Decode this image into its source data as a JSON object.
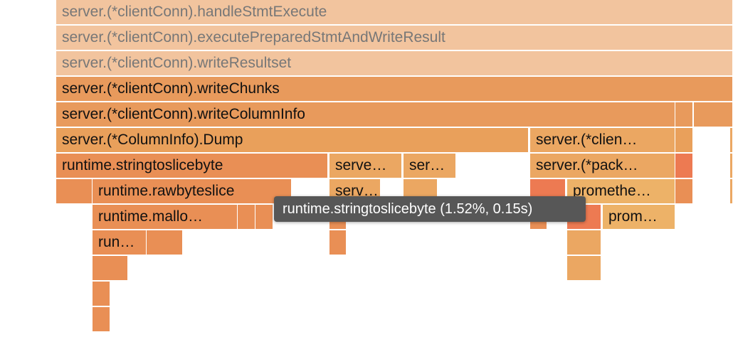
{
  "frames": [
    {
      "label": "server.(*clientConn).handleStmtExecute",
      "color": "#f2c49e",
      "dim": true
    },
    {
      "label": "server.(*clientConn).executePreparedStmtAndWriteResult",
      "color": "#f2c49e",
      "dim": true
    },
    {
      "label": "server.(*clientConn).writeResultset",
      "color": "#f2c49e",
      "dim": true
    },
    {
      "label": "server.(*clientConn).writeChunks",
      "color": "#e89a5c",
      "dim": false
    },
    {
      "label": "server.(*clientConn).writeColumnInfo",
      "color": "#e89a5c",
      "dim": false
    },
    {
      "label": "",
      "color": "#e89a5c",
      "dim": false
    },
    {
      "label": "",
      "color": "#e89a5c",
      "dim": false
    },
    {
      "label": "server.(*ColumnInfo).Dump",
      "color": "#e9a05b",
      "dim": false
    },
    {
      "label": "server.(*clien…",
      "color": "#eba762",
      "dim": false
    },
    {
      "label": "",
      "color": "#e9a05b",
      "dim": false
    },
    {
      "label": "",
      "color": "#eba762",
      "dim": false
    },
    {
      "label": "runtime.stringtoslicebyte",
      "color": "#e98f55",
      "dim": false
    },
    {
      "label": "serve…",
      "color": "#eba762",
      "dim": false
    },
    {
      "label": "ser…",
      "color": "#eba762",
      "dim": false
    },
    {
      "label": "server.(*pack…",
      "color": "#eba762",
      "dim": false
    },
    {
      "label": "",
      "color": "#ed7a52",
      "dim": false
    },
    {
      "label": "",
      "color": "#eba762",
      "dim": false
    },
    {
      "label": "",
      "color": "#e98f55",
      "dim": false
    },
    {
      "label": "runtime.rawbyteslice",
      "color": "#e98f55",
      "dim": false
    },
    {
      "label": "serve…",
      "color": "#eba762",
      "dim": false
    },
    {
      "label": "",
      "color": "#eba762",
      "dim": false
    },
    {
      "label": "",
      "color": "#ed7a52",
      "dim": false
    },
    {
      "label": "promethe…",
      "color": "#edb268",
      "dim": false
    },
    {
      "label": "",
      "color": "#e98f55",
      "dim": false
    },
    {
      "label": "",
      "color": "#eba762",
      "dim": false
    },
    {
      "label": "runtime.mallo…",
      "color": "#e98f55",
      "dim": false
    },
    {
      "label": "",
      "color": "#e98f55",
      "dim": false
    },
    {
      "label": "",
      "color": "#e98f55",
      "dim": false
    },
    {
      "label": "",
      "color": "#e98f55",
      "dim": false
    },
    {
      "label": "",
      "color": "#e98f55",
      "dim": false
    },
    {
      "label": "",
      "color": "#ed7a52",
      "dim": false
    },
    {
      "label": "prom…",
      "color": "#edb268",
      "dim": false
    },
    {
      "label": "run…",
      "color": "#e98f55",
      "dim": false
    },
    {
      "label": "",
      "color": "#e98f55",
      "dim": false
    },
    {
      "label": "",
      "color": "#e98f55",
      "dim": false
    },
    {
      "label": "",
      "color": "#eba762",
      "dim": false
    },
    {
      "label": "",
      "color": "#e98f55",
      "dim": false
    },
    {
      "label": "",
      "color": "#eba762",
      "dim": false
    },
    {
      "label": "",
      "color": "#e98f55",
      "dim": false
    },
    {
      "label": "",
      "color": "#e98f55",
      "dim": false
    }
  ],
  "tooltip": {
    "text": "runtime.stringtoslicebyte (1.52%, 0.15s)"
  }
}
